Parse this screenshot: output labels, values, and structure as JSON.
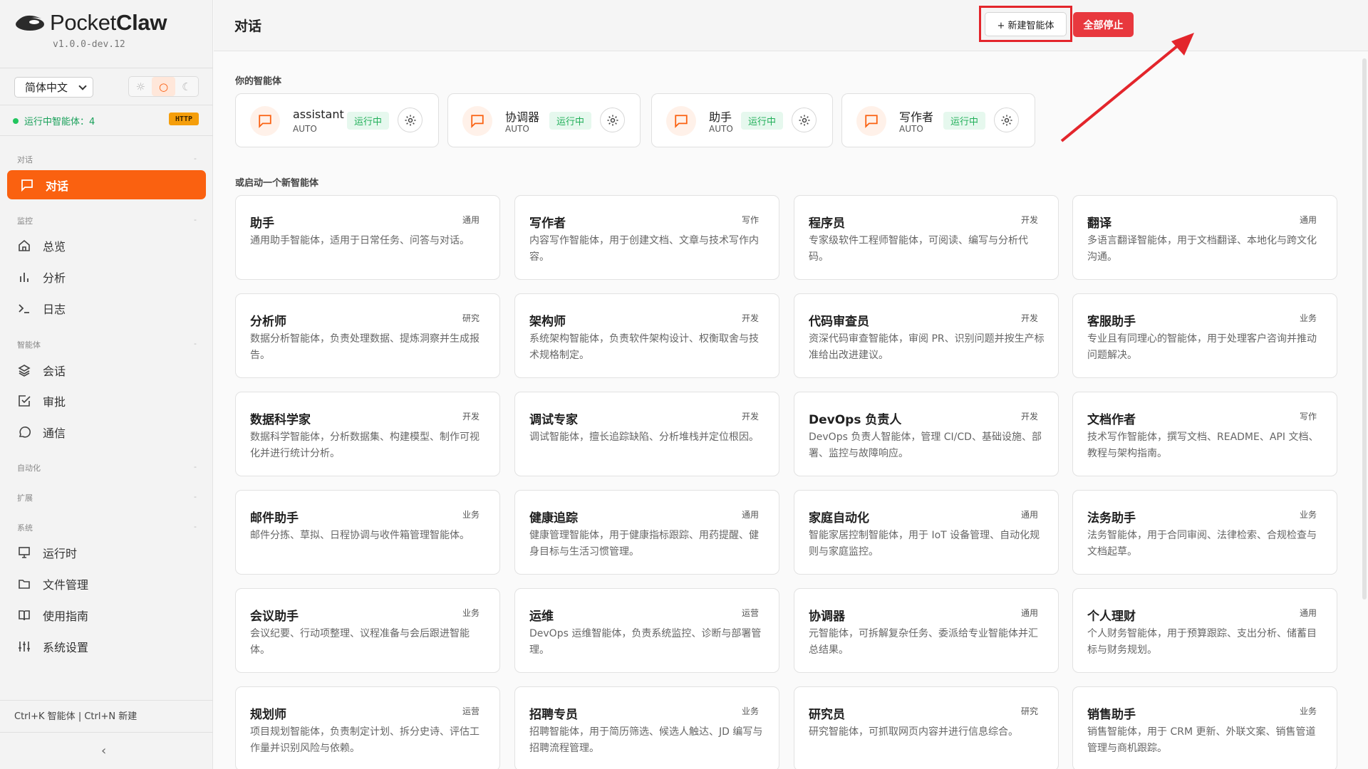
{
  "sidebar": {
    "brand": {
      "name_light": "Pocket",
      "name_bold": "Claw",
      "version": "v1.0.0-dev.12"
    },
    "language": "简体中文",
    "theme": {
      "light": "☼",
      "system": "○",
      "dark": "☾"
    },
    "running_status": "运行中智能体：4",
    "http_badge": "HTTP",
    "sections": {
      "chat": "对话",
      "monitor": "监控",
      "agents": "智能体",
      "automation": "自动化",
      "extensions": "扩展",
      "system": "系统"
    },
    "items": {
      "chat": "对话",
      "overview": "总览",
      "analytics": "分析",
      "logs": "日志",
      "sessions": "会话",
      "approvals": "审批",
      "comms": "通信",
      "runtime": "运行时",
      "files": "文件管理",
      "guide": "使用指南",
      "settings": "系统设置"
    },
    "shortcut_hint": "Ctrl+K 智能体 | Ctrl+N 新建",
    "collapse": "‹"
  },
  "header": {
    "title": "对话",
    "new_agent": "+ 新建智能体",
    "stop_all": "全部停止"
  },
  "your_agents_label": "你的智能体",
  "running_agents": [
    {
      "name": "assistant",
      "mode": "AUTO",
      "status": "运行中"
    },
    {
      "name": "协调器",
      "mode": "AUTO",
      "status": "运行中"
    },
    {
      "name": "助手",
      "mode": "AUTO",
      "status": "运行中"
    },
    {
      "name": "写作者",
      "mode": "AUTO",
      "status": "运行中"
    }
  ],
  "start_new_label": "或启动一个新智能体",
  "templates": [
    {
      "title": "助手",
      "tag": "通用",
      "desc": "通用助手智能体，适用于日常任务、问答与对话。"
    },
    {
      "title": "写作者",
      "tag": "写作",
      "desc": "内容写作智能体，用于创建文档、文章与技术写作内容。"
    },
    {
      "title": "程序员",
      "tag": "开发",
      "desc": "专家级软件工程师智能体，可阅读、编写与分析代码。"
    },
    {
      "title": "翻译",
      "tag": "通用",
      "desc": "多语言翻译智能体，用于文档翻译、本地化与跨文化沟通。"
    },
    {
      "title": "分析师",
      "tag": "研究",
      "desc": "数据分析智能体，负责处理数据、提炼洞察并生成报告。"
    },
    {
      "title": "架构师",
      "tag": "开发",
      "desc": "系统架构智能体，负责软件架构设计、权衡取舍与技术规格制定。"
    },
    {
      "title": "代码审查员",
      "tag": "开发",
      "desc": "资深代码审查智能体，审阅 PR、识别问题并按生产标准给出改进建议。"
    },
    {
      "title": "客服助手",
      "tag": "业务",
      "desc": "专业且有同理心的智能体，用于处理客户咨询并推动问题解决。"
    },
    {
      "title": "数据科学家",
      "tag": "开发",
      "desc": "数据科学智能体，分析数据集、构建模型、制作可视化并进行统计分析。"
    },
    {
      "title": "调试专家",
      "tag": "开发",
      "desc": "调试智能体，擅长追踪缺陷、分析堆栈并定位根因。"
    },
    {
      "title": "DevOps 负责人",
      "tag": "开发",
      "desc": "DevOps 负责人智能体，管理 CI/CD、基础设施、部署、监控与故障响应。"
    },
    {
      "title": "文档作者",
      "tag": "写作",
      "desc": "技术写作智能体，撰写文档、README、API 文档、教程与架构指南。"
    },
    {
      "title": "邮件助手",
      "tag": "业务",
      "desc": "邮件分拣、草拟、日程协调与收件箱管理智能体。"
    },
    {
      "title": "健康追踪",
      "tag": "通用",
      "desc": "健康管理智能体，用于健康指标跟踪、用药提醒、健身目标与生活习惯管理。"
    },
    {
      "title": "家庭自动化",
      "tag": "通用",
      "desc": "智能家居控制智能体，用于 IoT 设备管理、自动化规则与家庭监控。"
    },
    {
      "title": "法务助手",
      "tag": "业务",
      "desc": "法务智能体，用于合同审阅、法律检索、合规检查与文档起草。"
    },
    {
      "title": "会议助手",
      "tag": "业务",
      "desc": "会议纪要、行动项整理、议程准备与会后跟进智能体。"
    },
    {
      "title": "运维",
      "tag": "运营",
      "desc": "DevOps 运维智能体，负责系统监控、诊断与部署管理。"
    },
    {
      "title": "协调器",
      "tag": "通用",
      "desc": "元智能体，可拆解复杂任务、委派给专业智能体并汇总结果。"
    },
    {
      "title": "个人理财",
      "tag": "通用",
      "desc": "个人财务智能体，用于预算跟踪、支出分析、储蓄目标与财务规划。"
    },
    {
      "title": "规划师",
      "tag": "运营",
      "desc": "项目规划智能体，负责制定计划、拆分史诗、评估工作量并识别风险与依赖。"
    },
    {
      "title": "招聘专员",
      "tag": "业务",
      "desc": "招聘智能体，用于简历筛选、候选人触达、JD 编写与招聘流程管理。"
    },
    {
      "title": "研究员",
      "tag": "研究",
      "desc": "研究智能体，可抓取网页内容并进行信息综合。"
    },
    {
      "title": "销售助手",
      "tag": "业务",
      "desc": "销售智能体，用于 CRM 更新、外联文案、销售管道管理与商机跟踪。"
    }
  ],
  "colors": {
    "accent": "#fa6110",
    "danger": "#e8383e",
    "running_green": "#22b05a",
    "annotation_red": "#e3252b"
  }
}
